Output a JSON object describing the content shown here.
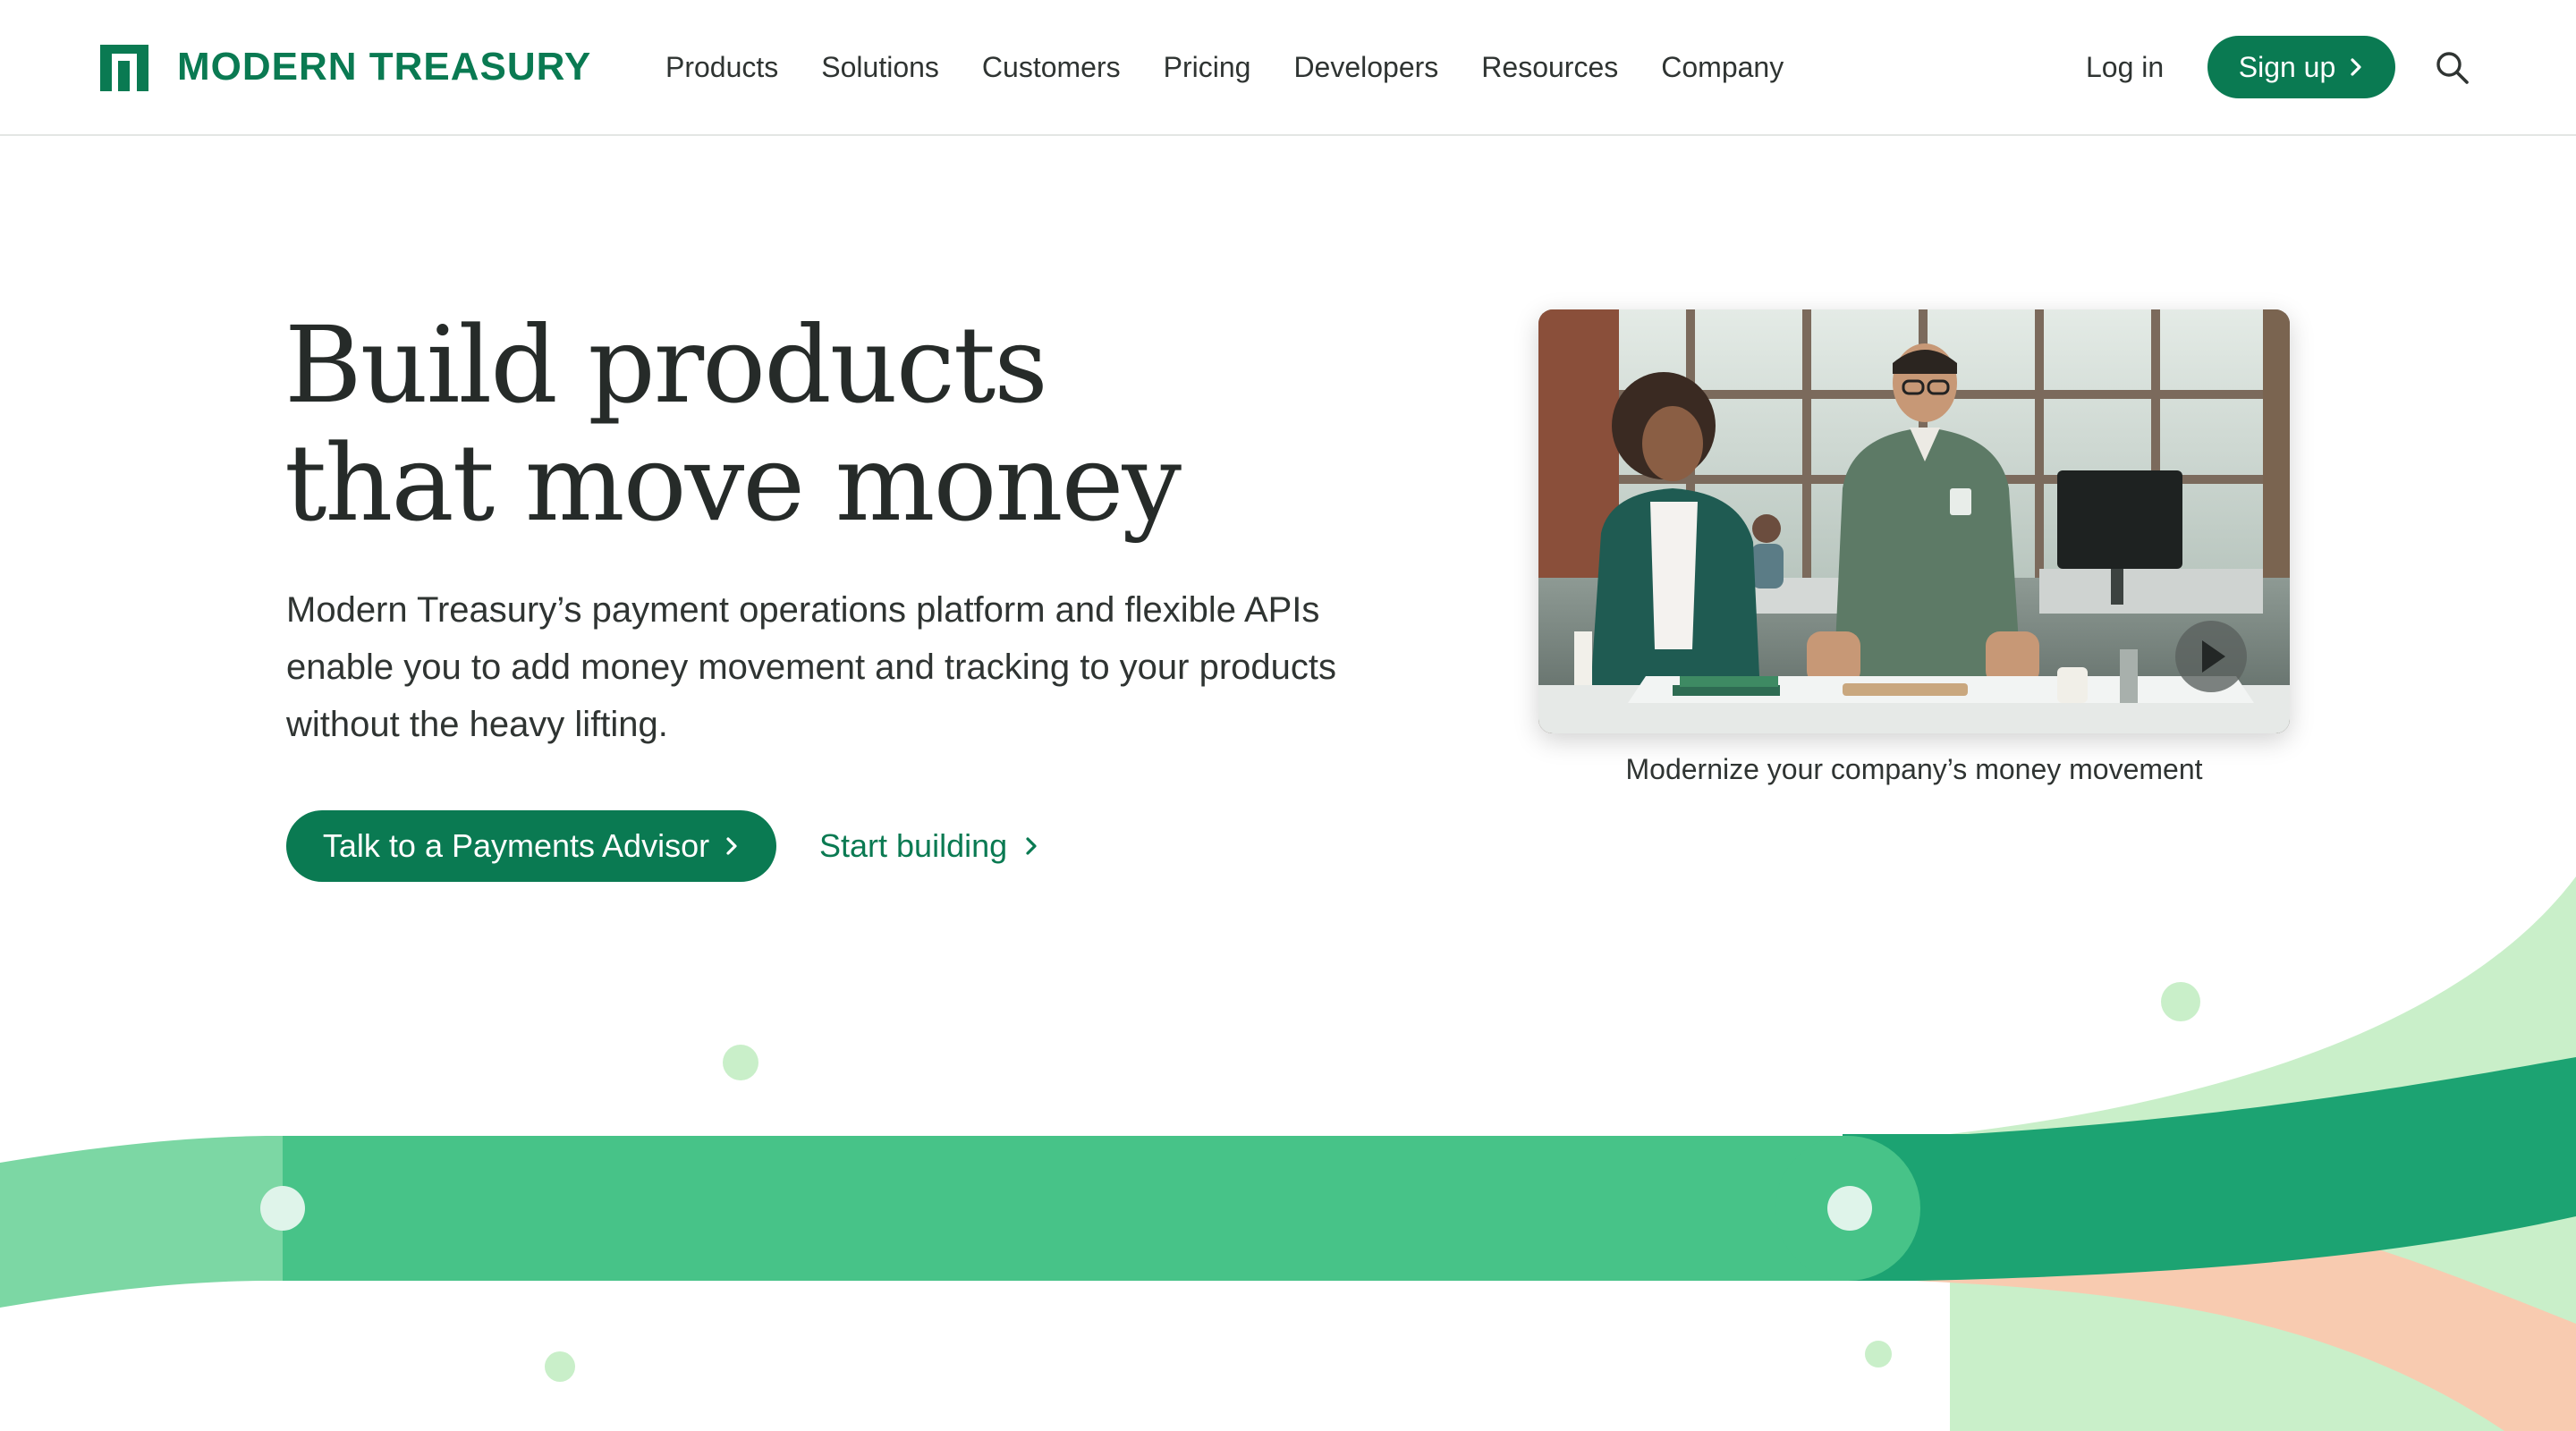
{
  "brand": {
    "name": "MODERN TREASURY",
    "color": "#0a7a52"
  },
  "nav": {
    "items": [
      {
        "label": "Products"
      },
      {
        "label": "Solutions"
      },
      {
        "label": "Customers"
      },
      {
        "label": "Pricing"
      },
      {
        "label": "Developers"
      },
      {
        "label": "Resources"
      },
      {
        "label": "Company"
      }
    ],
    "login_label": "Log in",
    "signup_label": "Sign up",
    "search_icon": "search-icon"
  },
  "hero": {
    "title_line1": "Build products",
    "title_line2": "that move money",
    "subtitle": "Modern Treasury’s payment operations platform and flexible APIs enable you to add money movement and tracking to your products without the heavy lifting.",
    "cta_primary": "Talk to a Payments Advisor",
    "cta_secondary": "Start building"
  },
  "video": {
    "caption": "Modernize your company’s money movement",
    "play_icon": "play-icon"
  },
  "colors": {
    "accent": "#0a7a52",
    "band_light": "#7cd7a4",
    "band_mid": "#47c388",
    "band_dark": "#1ca372",
    "mint": "#c9efc9",
    "peach": "#f8cbb0"
  }
}
